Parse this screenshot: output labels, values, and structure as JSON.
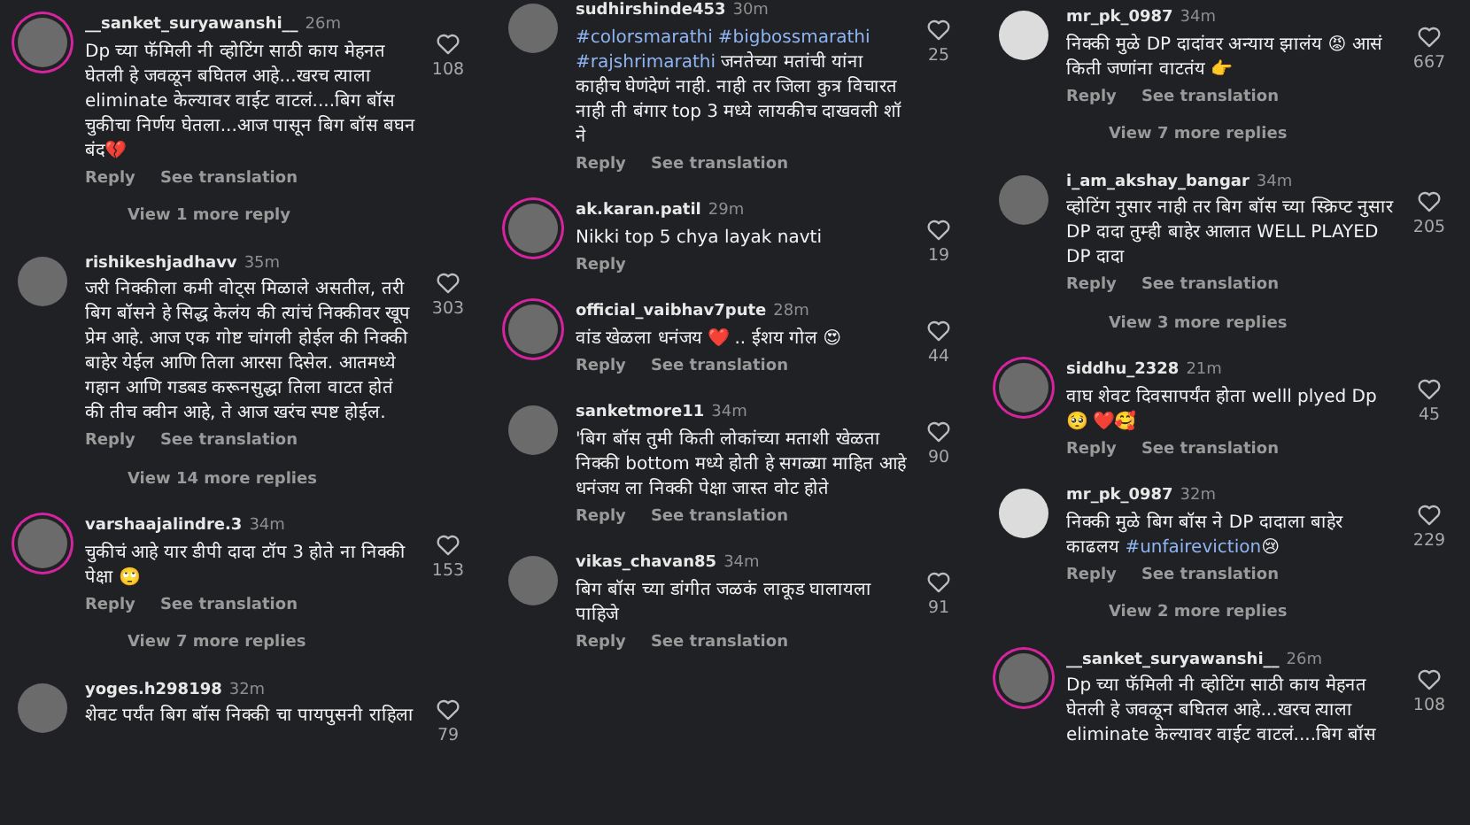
{
  "columns": [
    {
      "comments": [
        {
          "username": "__sanket_suryawanshi__",
          "time": "26m",
          "default_avatar": false,
          "story_ring": true,
          "parts": [
            {
              "kind": "text",
              "text": "Dp च्या फॅमिली नी व्होटिंग साठी काय मेहनत घेतली हे जवळून बघितल आहे...खरच त्याला eliminate केल्यावर वाईट वाटलं....बिग बॉस चुकीचा निर्णय घेतला...आज पासून बिग बॉस बघन बंद💔"
            }
          ],
          "actions": [
            "Reply",
            "See translation"
          ],
          "likes": "108",
          "view_replies": "View 1 more reply"
        },
        {
          "username": "rishikeshjadhavv",
          "time": "35m",
          "default_avatar": false,
          "story_ring": false,
          "parts": [
            {
              "kind": "text",
              "text": "जरी निक्कीला कमी वोट्स मिळाले असतील, तरी बिग बॉसने हे सिद्ध केलंय की त्यांचं निक्कीवर खूप प्रेम आहे. आज एक गोष्ट चांगली होईल की निक्की बाहेर येईल आणि तिला आरसा दिसेल. आतमध्ये गहान आणि गडबड करूनसुद्धा तिला वाटत होतं की तीच क्वीन आहे, ते आज खरंच स्पष्ट होईल."
            }
          ],
          "actions": [
            "Reply",
            "See translation"
          ],
          "likes": "303",
          "view_replies": "View 14 more replies"
        },
        {
          "username": "varshaajalindre.3",
          "time": "34m",
          "default_avatar": false,
          "story_ring": true,
          "parts": [
            {
              "kind": "text",
              "text": "चुकीचं आहे यार डीपी दादा टॉप 3 होते ना निक्की पेक्षा 🙄"
            }
          ],
          "actions": [
            "Reply",
            "See translation"
          ],
          "likes": "153",
          "view_replies": "View 7 more replies"
        },
        {
          "username": "yoges.h298198",
          "time": "32m",
          "default_avatar": false,
          "story_ring": false,
          "parts": [
            {
              "kind": "text",
              "text": "शेवट पर्यंत बिग बॉस निक्की चा पायपुसनी राहिला"
            }
          ],
          "likes": "79"
        }
      ]
    },
    {
      "comments": [
        {
          "username": "sudhirshinde453",
          "time": "30m",
          "default_avatar": false,
          "story_ring": false,
          "parts": [
            {
              "kind": "hashtag",
              "text": "#colorsmarathi"
            },
            {
              "kind": "hashtag",
              "text": "#bigbossmarathi"
            },
            {
              "kind": "hashtag",
              "text": "#rajshrimarathi"
            },
            {
              "kind": "text",
              "text": " जनतेच्या मतांची यांना काहीच घेणंदेणं नाही. नाही तर जिला कुत्र विचारत नाही ती बंगार top 3 मध्ये लायकीच दाखवली शॉ ने"
            }
          ],
          "actions": [
            "Reply",
            "See translation"
          ],
          "likes": "25"
        },
        {
          "username": "ak.karan.patil",
          "time": "29m",
          "default_avatar": false,
          "story_ring": true,
          "parts": [
            {
              "kind": "text",
              "text": "Nikki top 5 chya layak navti"
            }
          ],
          "actions": [
            "Reply"
          ],
          "likes": "19"
        },
        {
          "username": "official_vaibhav7pute",
          "time": "28m",
          "default_avatar": false,
          "story_ring": true,
          "parts": [
            {
              "kind": "text",
              "text": "वांड खेळला धनंजय ❤️ .. ईशय गोल 😍"
            }
          ],
          "actions": [
            "Reply",
            "See translation"
          ],
          "likes": "44"
        },
        {
          "username": "sanketmore11",
          "time": "34m",
          "default_avatar": false,
          "story_ring": false,
          "parts": [
            {
              "kind": "text",
              "text": "'बिग बॉस तुमी किती लोकांच्या मताशी खेळता निक्की bottom मध्ये होती हे सगळ्या माहित आहे धनंजय ला निक्की पेक्षा जास्त वोट होते"
            }
          ],
          "actions": [
            "Reply",
            "See translation"
          ],
          "likes": "90"
        },
        {
          "username": "vikas_chavan85",
          "time": "34m",
          "default_avatar": false,
          "story_ring": false,
          "parts": [
            {
              "kind": "text",
              "text": "बिग बॉस च्या डांगीत जळकं लाकूड घालायला पाहिजे"
            }
          ],
          "actions": [
            "Reply",
            "See translation"
          ],
          "likes": "91"
        }
      ]
    },
    {
      "comments": [
        {
          "username": "mr_pk_0987",
          "time": "34m",
          "default_avatar": true,
          "story_ring": false,
          "parts": [
            {
              "kind": "text",
              "text": "निक्की मुळे DP दादांवर अन्याय झालंय 😡 आसं किती जणांना वाटतंय 👉"
            }
          ],
          "actions": [
            "Reply",
            "See translation"
          ],
          "likes": "667",
          "view_replies": "View 7 more replies"
        },
        {
          "username": "i_am_akshay_bangar",
          "time": "34m",
          "default_avatar": false,
          "story_ring": false,
          "parts": [
            {
              "kind": "text",
              "text": "व्होटिंग नुसार नाही तर बिग बॉस च्या स्क्रिप्ट नुसार DP दादा तुम्ही बाहेर आलात WELL PLAYED DP दादा"
            }
          ],
          "actions": [
            "Reply",
            "See translation"
          ],
          "likes": "205",
          "view_replies": "View 3 more replies"
        },
        {
          "username": "siddhu_2328",
          "time": "21m",
          "default_avatar": false,
          "story_ring": true,
          "parts": [
            {
              "kind": "text",
              "text": "वाघ शेवट दिवसापर्यंत होता welll plyed Dp🥺 ❤️🥰"
            }
          ],
          "actions": [
            "Reply",
            "See translation"
          ],
          "likes": "45"
        },
        {
          "username": "mr_pk_0987",
          "time": "32m",
          "default_avatar": true,
          "story_ring": false,
          "parts": [
            {
              "kind": "text",
              "text": "निक्की मुळे बिग बॉस ने DP दादाला बाहेर काढलय "
            },
            {
              "kind": "hashtag",
              "text": "#unfaireviction"
            },
            {
              "kind": "text",
              "text": "😢"
            }
          ],
          "actions": [
            "Reply",
            "See translation"
          ],
          "likes": "229",
          "view_replies": "View 2 more replies"
        },
        {
          "username": "__sanket_suryawanshi__",
          "time": "26m",
          "default_avatar": false,
          "story_ring": true,
          "parts": [
            {
              "kind": "text",
              "text": "Dp च्या फॅमिली नी व्होटिंग साठी काय मेहनत घेतली हे जवळून बघितल आहे...खरच त्याला eliminate केल्यावर वाईट वाटलं....बिग बॉस"
            }
          ],
          "likes": "108"
        }
      ]
    }
  ]
}
